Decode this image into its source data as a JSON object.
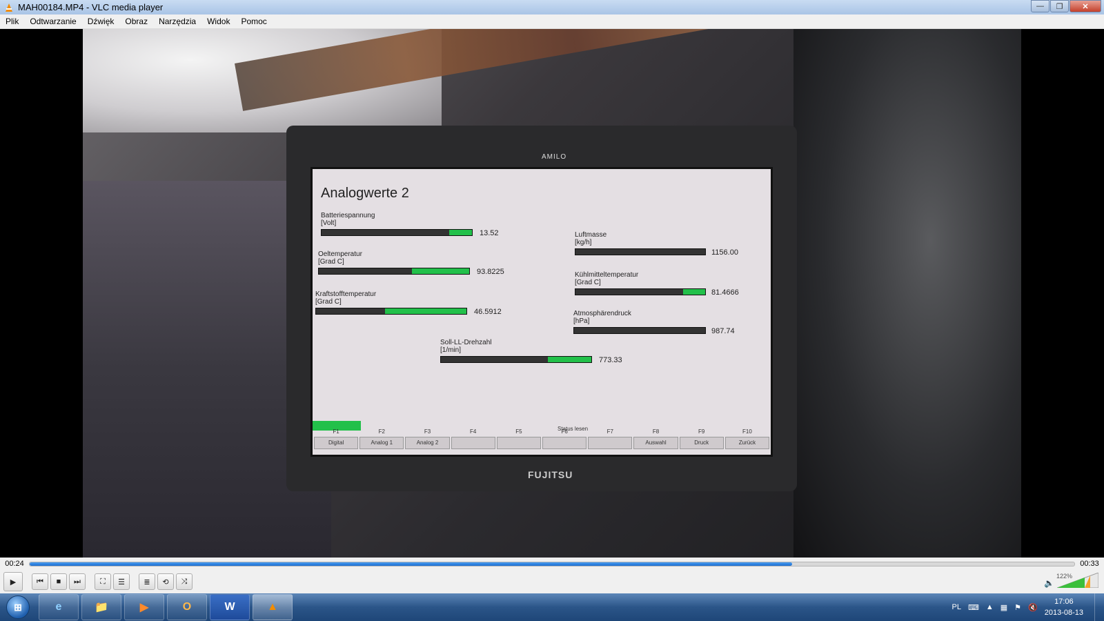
{
  "window": {
    "title": "MAH00184.MP4 - VLC media player"
  },
  "menu": {
    "items": [
      "Plik",
      "Odtwarzanie",
      "Dźwięk",
      "Obraz",
      "Narzędzia",
      "Widok",
      "Pomoc"
    ]
  },
  "video": {
    "laptop_brand": "AMILO",
    "laptop_maker": "FUJITSU",
    "screen_title": "Analogwerte 2",
    "gauges": [
      {
        "label1": "Batteriespannung",
        "label2": "[Volt]",
        "value": "13.52",
        "fill": 0.15
      },
      {
        "label1": "Oeltemperatur",
        "label2": "[Grad C]",
        "value": "93.8225",
        "fill": 0.38
      },
      {
        "label1": "Kraftstofftemperatur",
        "label2": "[Grad C]",
        "value": "46.5912",
        "fill": 0.54
      },
      {
        "label1": "Luftmasse",
        "label2": "[kg/h]",
        "value": "1156.00",
        "fill": 0.0
      },
      {
        "label1": "Kühlmitteltemperatur",
        "label2": "[Grad C]",
        "value": "81.4666",
        "fill": 0.17
      },
      {
        "label1": "Atmosphärendruck",
        "label2": "[hPa]",
        "value": "987.74",
        "fill": 0.0
      },
      {
        "label1": "Soll-LL-Drehzahl",
        "label2": "[1/min]",
        "value": "773.33",
        "fill": 0.29
      }
    ],
    "status_lesen": "Status lesen",
    "fkeys": [
      {
        "n": "F1",
        "label": "Digital"
      },
      {
        "n": "F2",
        "label": "Analog 1"
      },
      {
        "n": "F3",
        "label": "Analog 2"
      },
      {
        "n": "F4",
        "label": ""
      },
      {
        "n": "F5",
        "label": ""
      },
      {
        "n": "F6",
        "label": ""
      },
      {
        "n": "F7",
        "label": ""
      },
      {
        "n": "F8",
        "label": "Auswahl"
      },
      {
        "n": "F9",
        "label": "Druck"
      },
      {
        "n": "F10",
        "label": "Zurück"
      }
    ]
  },
  "playback": {
    "elapsed": "00:24",
    "total": "00:33",
    "progress": 0.73,
    "volume_label": "122%",
    "volume_level": 1.22
  },
  "controls": {
    "play": "▶",
    "prev": "⏮",
    "stop": "■",
    "next": "⏭",
    "fullscreen": "⛶",
    "ext_settings": "☰",
    "playlist": "≣",
    "loop": "⟲",
    "shuffle": "⤨",
    "volume_icon": "🔈"
  },
  "taskbar": {
    "apps": [
      "e",
      "📁",
      "▶",
      "O",
      "W",
      "▲"
    ],
    "language": "PL",
    "time": "17:06",
    "date": "2013-08-13"
  },
  "colors": {
    "gauge_fill": "#22c04a",
    "seek_fill": "#1c6ed0",
    "taskbar": "#2b5588"
  }
}
